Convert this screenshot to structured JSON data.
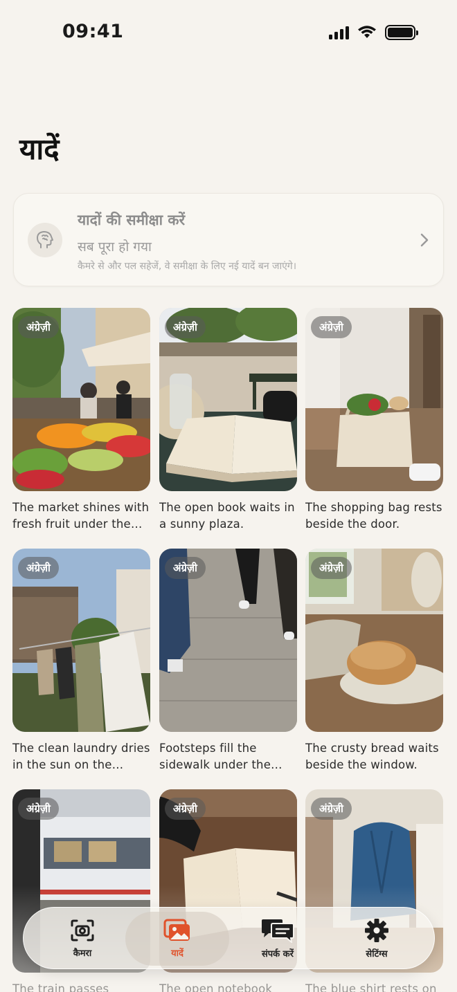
{
  "status": {
    "time": "09:41"
  },
  "page": {
    "title": "यादें"
  },
  "review": {
    "title": "यादों की समीक्षा करें",
    "status": "सब पूरा हो गया",
    "description": "कैमरे से और पल सहेजें, वे समीक्षा के लिए नई यादें बन जाएंगे।",
    "icon": "brain-icon"
  },
  "memories": [
    {
      "badge": "अंग्रेज़ी",
      "caption": "The market shines with fresh fruit under the sun."
    },
    {
      "badge": "अंग्रेज़ी",
      "caption": "The open book waits in a sunny plaza."
    },
    {
      "badge": "अंग्रेज़ी",
      "caption": "The shopping bag rests beside the door."
    },
    {
      "badge": "अंग्रेज़ी",
      "caption": "The clean laundry dries in the sun on the balcony."
    },
    {
      "badge": "अंग्रेज़ी",
      "caption": "Footsteps fill the sidewalk under the trees."
    },
    {
      "badge": "अंग्रेज़ी",
      "caption": "The crusty bread waits beside the window."
    },
    {
      "badge": "अंग्रेज़ी",
      "caption": "The train passes quickly"
    },
    {
      "badge": "अंग्रेज़ी",
      "caption": "The open notebook"
    },
    {
      "badge": "अंग्रेज़ी",
      "caption": "The blue shirt rests on"
    }
  ],
  "tabbar": {
    "tabs": [
      {
        "label": "कैमरा",
        "icon": "camera-icon",
        "active": false
      },
      {
        "label": "यादें",
        "icon": "photos-icon",
        "active": true
      },
      {
        "label": "संपर्क करें",
        "icon": "chat-icon",
        "active": false
      },
      {
        "label": "सेटिंग्स",
        "icon": "gear-icon",
        "active": false
      }
    ]
  },
  "colors": {
    "accent": "#e0522b",
    "background": "#f6f3ee"
  }
}
